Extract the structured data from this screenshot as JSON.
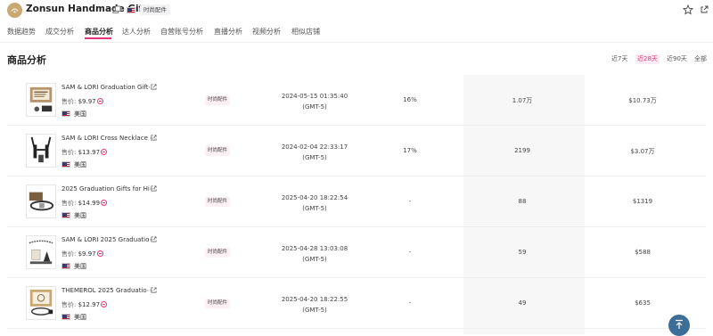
{
  "shop": {
    "name": "Zonsun Handmade Gifts",
    "category": "时尚配件"
  },
  "tabs": [
    {
      "label": "数据趋势"
    },
    {
      "label": "成交分析"
    },
    {
      "label": "商品分析",
      "active": true
    },
    {
      "label": "达人分析"
    },
    {
      "label": "自营账号分析"
    },
    {
      "label": "直播分析"
    },
    {
      "label": "视频分析"
    },
    {
      "label": "相似店铺"
    }
  ],
  "section_title": "商品分析",
  "ranges": [
    {
      "label": "近7天"
    },
    {
      "label": "近28天",
      "active": true
    },
    {
      "label": "近90天"
    },
    {
      "label": "全部"
    }
  ],
  "price_label": "售价:",
  "products": [
    {
      "name": "SAM & LORI Graduation Gift⋯",
      "price": "$9.97",
      "country": "美国",
      "category": "时尚配件",
      "date": "2024-05-15 01:35:40",
      "tz": "(GMT-5)",
      "rate": "16%",
      "sales": "1.07万",
      "gmv": "$10.73万"
    },
    {
      "name": "SAM & LORI Cross Necklace ⋯",
      "price": "$13.97",
      "country": "美国",
      "category": "时尚配件",
      "date": "2024-02-04 22:33:17",
      "tz": "(GMT-5)",
      "rate": "17%",
      "sales": "2199",
      "gmv": "$3.07万"
    },
    {
      "name": "2025 Graduation Gifts for Hi⋯",
      "price": "$14.99",
      "country": "美国",
      "category": "时尚配件",
      "date": "2025-04-20 18:22:54",
      "tz": "(GMT-5)",
      "rate": "-",
      "sales": "88",
      "gmv": "$1319"
    },
    {
      "name": "SAM & LORI 2025 Graduatio⋯",
      "price": "$9.97",
      "country": "美国",
      "category": "时尚配件",
      "date": "2025-04-28 13:03:08",
      "tz": "(GMT-5)",
      "rate": "-",
      "sales": "59",
      "gmv": "$588"
    },
    {
      "name": "THEMEROL 2025 Graduatio⋯",
      "price": "$12.97",
      "country": "美国",
      "category": "时尚配件",
      "date": "2025-04-20 18:22:55",
      "tz": "(GMT-5)",
      "rate": "-",
      "sales": "49",
      "gmv": "$635"
    }
  ],
  "icons": [
    "shop-logo-icon",
    "copy-icon",
    "us-flag-icon",
    "star-icon",
    "share-icon",
    "external-link-icon",
    "back-to-top-icon"
  ],
  "colors": {
    "accent": "#e8327a",
    "top_button": "#3d6e98"
  }
}
